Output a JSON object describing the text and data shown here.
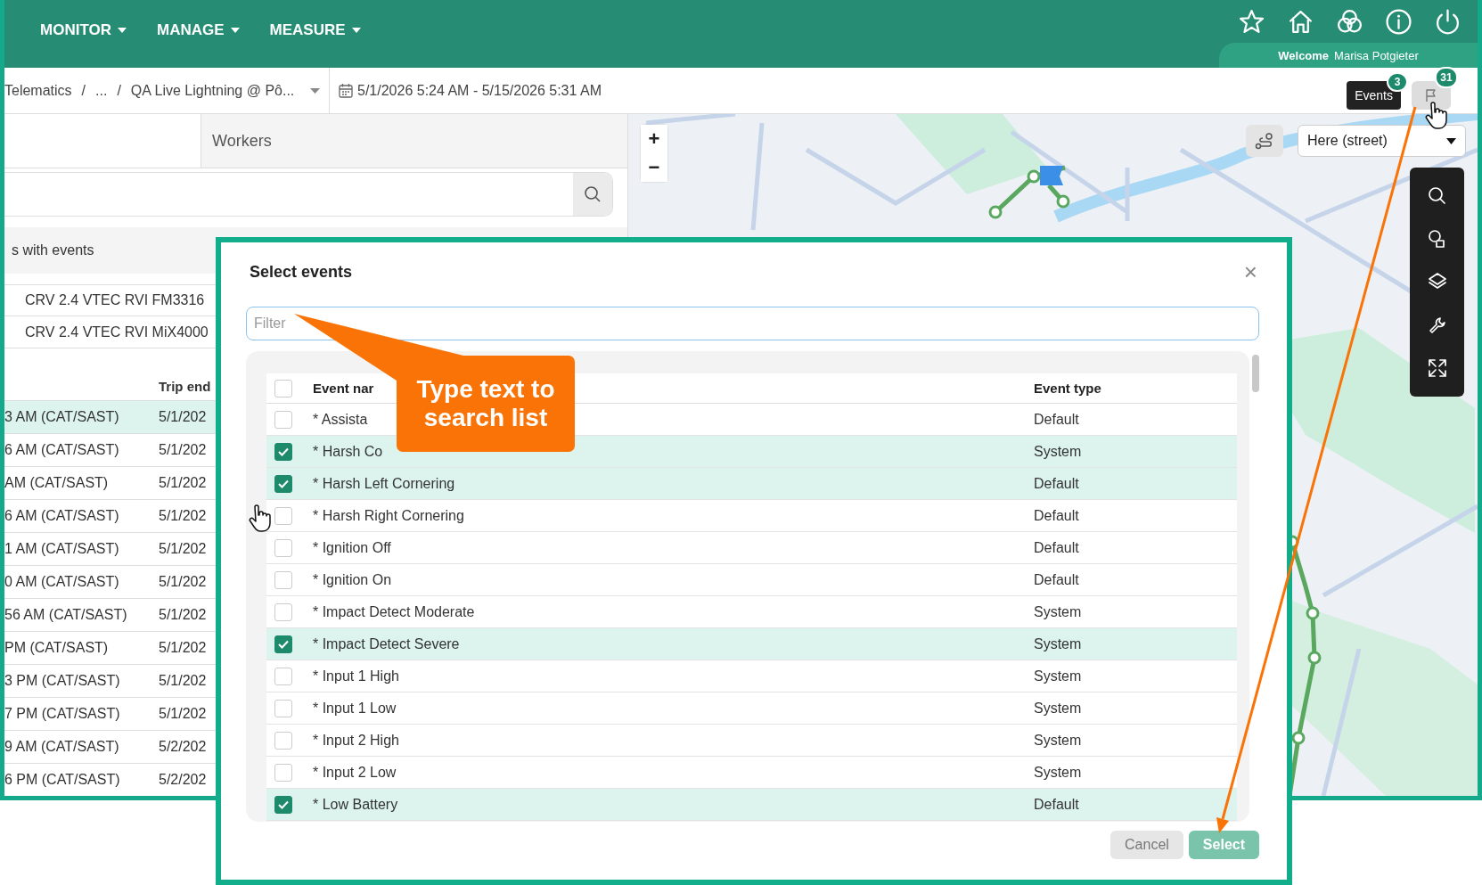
{
  "top_bar": {
    "menus": [
      {
        "label": "MONITOR"
      },
      {
        "label": "MANAGE"
      },
      {
        "label": "MEASURE"
      }
    ],
    "welcome_label": "Welcome",
    "user_name": "Marisa Potgieter"
  },
  "breadcrumb": {
    "items": [
      {
        "kind": "crumb",
        "label": "Telematics"
      },
      {
        "kind": "separator",
        "label": "/"
      },
      {
        "kind": "crumb",
        "label": "..."
      },
      {
        "kind": "separator",
        "label": "/"
      },
      {
        "kind": "dropdown",
        "label": "QA Live Lightning @ Pô..."
      }
    ],
    "date_range": "5/1/2026 5:24 AM - 5/15/2026 5:31 AM",
    "tooltip": "Events",
    "badges": [
      "3",
      "31"
    ]
  },
  "left_panel": {
    "tab": "Workers",
    "list_header": "s with events",
    "vehicles": [
      "CRV 2.4 VTEC RVI FM3316",
      "CRV 2.4 VTEC RVI MiX4000"
    ],
    "columns": [
      "Trip end"
    ],
    "trips": [
      {
        "column_1": "3 AM (CAT/SAST)",
        "trip_end": "5/1/202",
        "selected": true
      },
      {
        "column_1": "6 AM (CAT/SAST)",
        "trip_end": "5/1/202",
        "selected": false
      },
      {
        "column_1": "AM (CAT/SAST)",
        "trip_end": "5/1/202",
        "selected": false
      },
      {
        "column_1": "6 AM (CAT/SAST)",
        "trip_end": "5/1/202",
        "selected": false
      },
      {
        "column_1": "1 AM (CAT/SAST)",
        "trip_end": "5/1/202",
        "selected": false
      },
      {
        "column_1": "0 AM (CAT/SAST)",
        "trip_end": "5/1/202",
        "selected": false
      },
      {
        "column_1": "56 AM (CAT/SAST)",
        "trip_end": "5/1/202",
        "selected": false
      },
      {
        "column_1": "PM (CAT/SAST)",
        "trip_end": "5/1/202",
        "selected": false
      },
      {
        "column_1": "3 PM (CAT/SAST)",
        "trip_end": "5/1/202",
        "selected": false
      },
      {
        "column_1": "7 PM (CAT/SAST)",
        "trip_end": "5/1/202",
        "selected": false
      },
      {
        "column_1": "9 AM (CAT/SAST)",
        "trip_end": "5/2/202",
        "selected": false
      },
      {
        "column_1": "6 PM (CAT/SAST)",
        "trip_end": "5/2/202",
        "selected": false
      }
    ]
  },
  "map": {
    "kind": "picture",
    "zoom_in": "+",
    "zoom_out": "−",
    "map_type": "Here (street)"
  },
  "modal": {
    "title": "Select events",
    "close": "×",
    "filter_placeholder": "Filter",
    "columns": [
      "Event nar",
      "Event type"
    ],
    "select_all": {
      "checked": false
    },
    "rows": [
      {
        "name": "* Assista",
        "type": "Default",
        "checked": false
      },
      {
        "name": "* Harsh Co",
        "type": "System",
        "checked": true
      },
      {
        "name": "* Harsh Left Cornering",
        "type": "Default",
        "checked": true
      },
      {
        "name": "* Harsh Right Cornering",
        "type": "Default",
        "checked": false
      },
      {
        "name": "* Ignition Off",
        "type": "Default",
        "checked": false
      },
      {
        "name": "* Ignition On",
        "type": "Default",
        "checked": false
      },
      {
        "name": "* Impact Detect Moderate",
        "type": "System",
        "checked": false
      },
      {
        "name": "* Impact Detect Severe",
        "type": "System",
        "checked": true
      },
      {
        "name": "* Input 1 High",
        "type": "System",
        "checked": false
      },
      {
        "name": "* Input 1 Low",
        "type": "System",
        "checked": false
      },
      {
        "name": "* Input 2 High",
        "type": "System",
        "checked": false
      },
      {
        "name": "* Input 2 Low",
        "type": "System",
        "checked": false
      },
      {
        "name": "* Low Battery",
        "type": "Default",
        "checked": true
      }
    ],
    "buttons": [
      {
        "label": "Cancel",
        "kind": "secondary"
      },
      {
        "label": "Select",
        "kind": "primary"
      }
    ],
    "callout": "Type text to search list"
  }
}
